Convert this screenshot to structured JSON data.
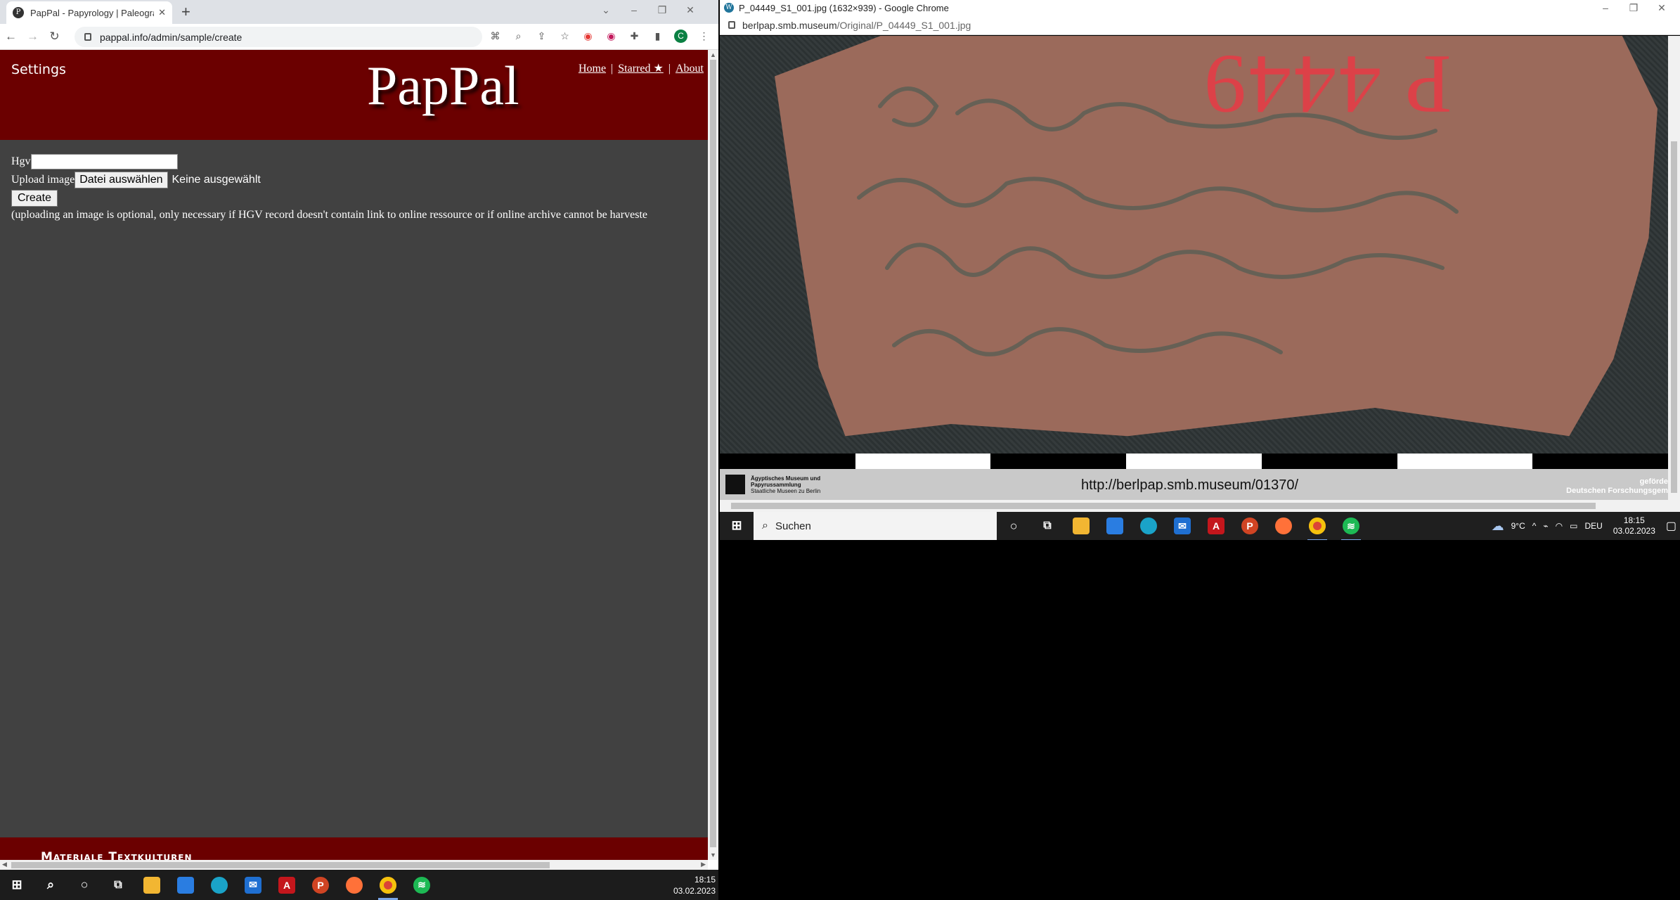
{
  "left_browser": {
    "tab_title": "PapPal - Papyrology | Paleograph",
    "tab_favicon": "P",
    "url": "pappal.info/admin/sample/create",
    "avatar_letter": "C"
  },
  "page": {
    "settings": "Settings",
    "logo": "PapPal",
    "nav": {
      "home": "Home",
      "starred": "Starred ★",
      "about": "About",
      "sep": "|"
    },
    "form": {
      "hgv_label": "Hgv",
      "hgv_value": "",
      "upload_label": "Upload image",
      "file_button": "Datei auswählen",
      "file_none": "Keine ausgewählt",
      "create_button": "Create",
      "note": "(uploading an image is optional, only necessary if HGV record doesn't contain link to online ressource or if online archive cannot be harveste"
    },
    "footer": "Materiale Textkulturen"
  },
  "left_taskbar": {
    "time": "18:15",
    "date": "03.02.2023"
  },
  "right_browser": {
    "favicon": "W",
    "title": "P_04449_S1_001.jpg (1632×939) - Google Chrome",
    "url_domain": "berlpap.smb.museum",
    "url_path": "/Original/P_04449_S1_001.jpg",
    "image": {
      "red_label": "P 4449",
      "museum_lines": [
        "Ägyptisches Museum und",
        "Papyrussammlung",
        "Staatliche Museen zu Berlin"
      ],
      "caption_url": "http://berlpap.smb.museum/01370/",
      "funding_lines": [
        "geförde",
        "Deutschen Forschungsgem"
      ]
    },
    "taskbar": {
      "search": "Suchen",
      "weather": "9°C",
      "lang": "DEU",
      "time": "18:15",
      "date": "03.02.2023"
    }
  },
  "colors": {
    "header": "#6b0000",
    "page_bg": "#414141",
    "sherd": "#9b6a5b"
  }
}
